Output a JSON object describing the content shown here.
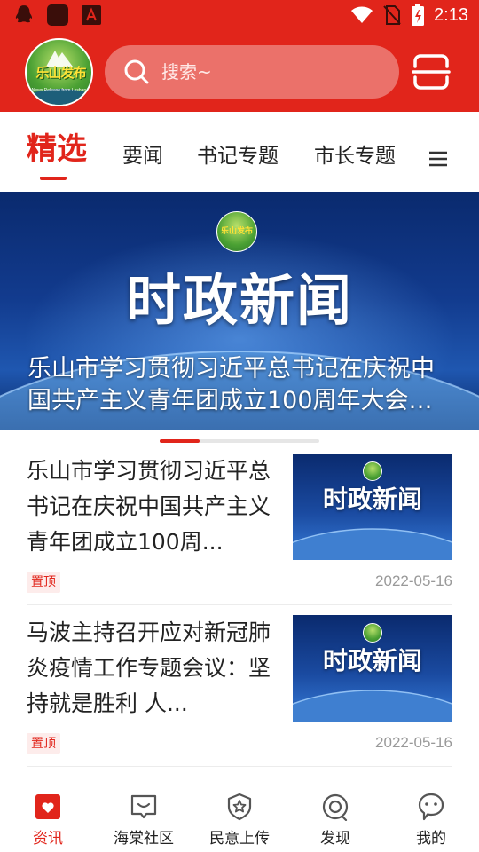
{
  "status_bar": {
    "time": "2:13",
    "left_icons": [
      "qq-icon",
      "app-icon",
      "app-a-icon"
    ],
    "right_icons": [
      "wifi-icon",
      "no-sim-icon",
      "battery-icon"
    ]
  },
  "header": {
    "logo_text": "乐山发布",
    "logo_subtext": "News Release from Leshan",
    "search_placeholder": "搜索~",
    "scan_icon": "scan-icon"
  },
  "tabs": [
    {
      "label": "精选",
      "active": true
    },
    {
      "label": "要闻",
      "active": false
    },
    {
      "label": "书记专题",
      "active": false
    },
    {
      "label": "市长专题",
      "active": false
    }
  ],
  "banner": {
    "logo_text": "乐山发布",
    "heading": "时政新闻",
    "caption": "乐山市学习贯彻习近平总书记在庆祝中国共产主义青年团成立100周年大会上..."
  },
  "carousel": {
    "active_index": 0,
    "count": 4
  },
  "news": [
    {
      "title": "乐山市学习贯彻习近平总书记在庆祝中国共产主义青年团成立100周...",
      "badge": "置顶",
      "date": "2022-05-16",
      "thumb_logo_text": "乐山发布",
      "thumb_title": "时政新闻"
    },
    {
      "title": "马波主持召开应对新冠肺炎疫情工作专题会议：坚持就是胜利 人...",
      "badge": "置顶",
      "date": "2022-05-16",
      "thumb_logo_text": "乐山发布",
      "thumb_title": "时政新闻"
    }
  ],
  "bottom_nav": [
    {
      "label": "资讯",
      "icon": "news-icon",
      "active": true
    },
    {
      "label": "海棠社区",
      "icon": "community-icon",
      "active": false
    },
    {
      "label": "民意上传",
      "icon": "upload-opinion-icon",
      "active": false
    },
    {
      "label": "发现",
      "icon": "discover-icon",
      "active": false
    },
    {
      "label": "我的",
      "icon": "profile-icon",
      "active": false
    }
  ],
  "colors": {
    "brand": "#e1251b",
    "date": "#999999",
    "badge_bg": "#fdeceb"
  }
}
